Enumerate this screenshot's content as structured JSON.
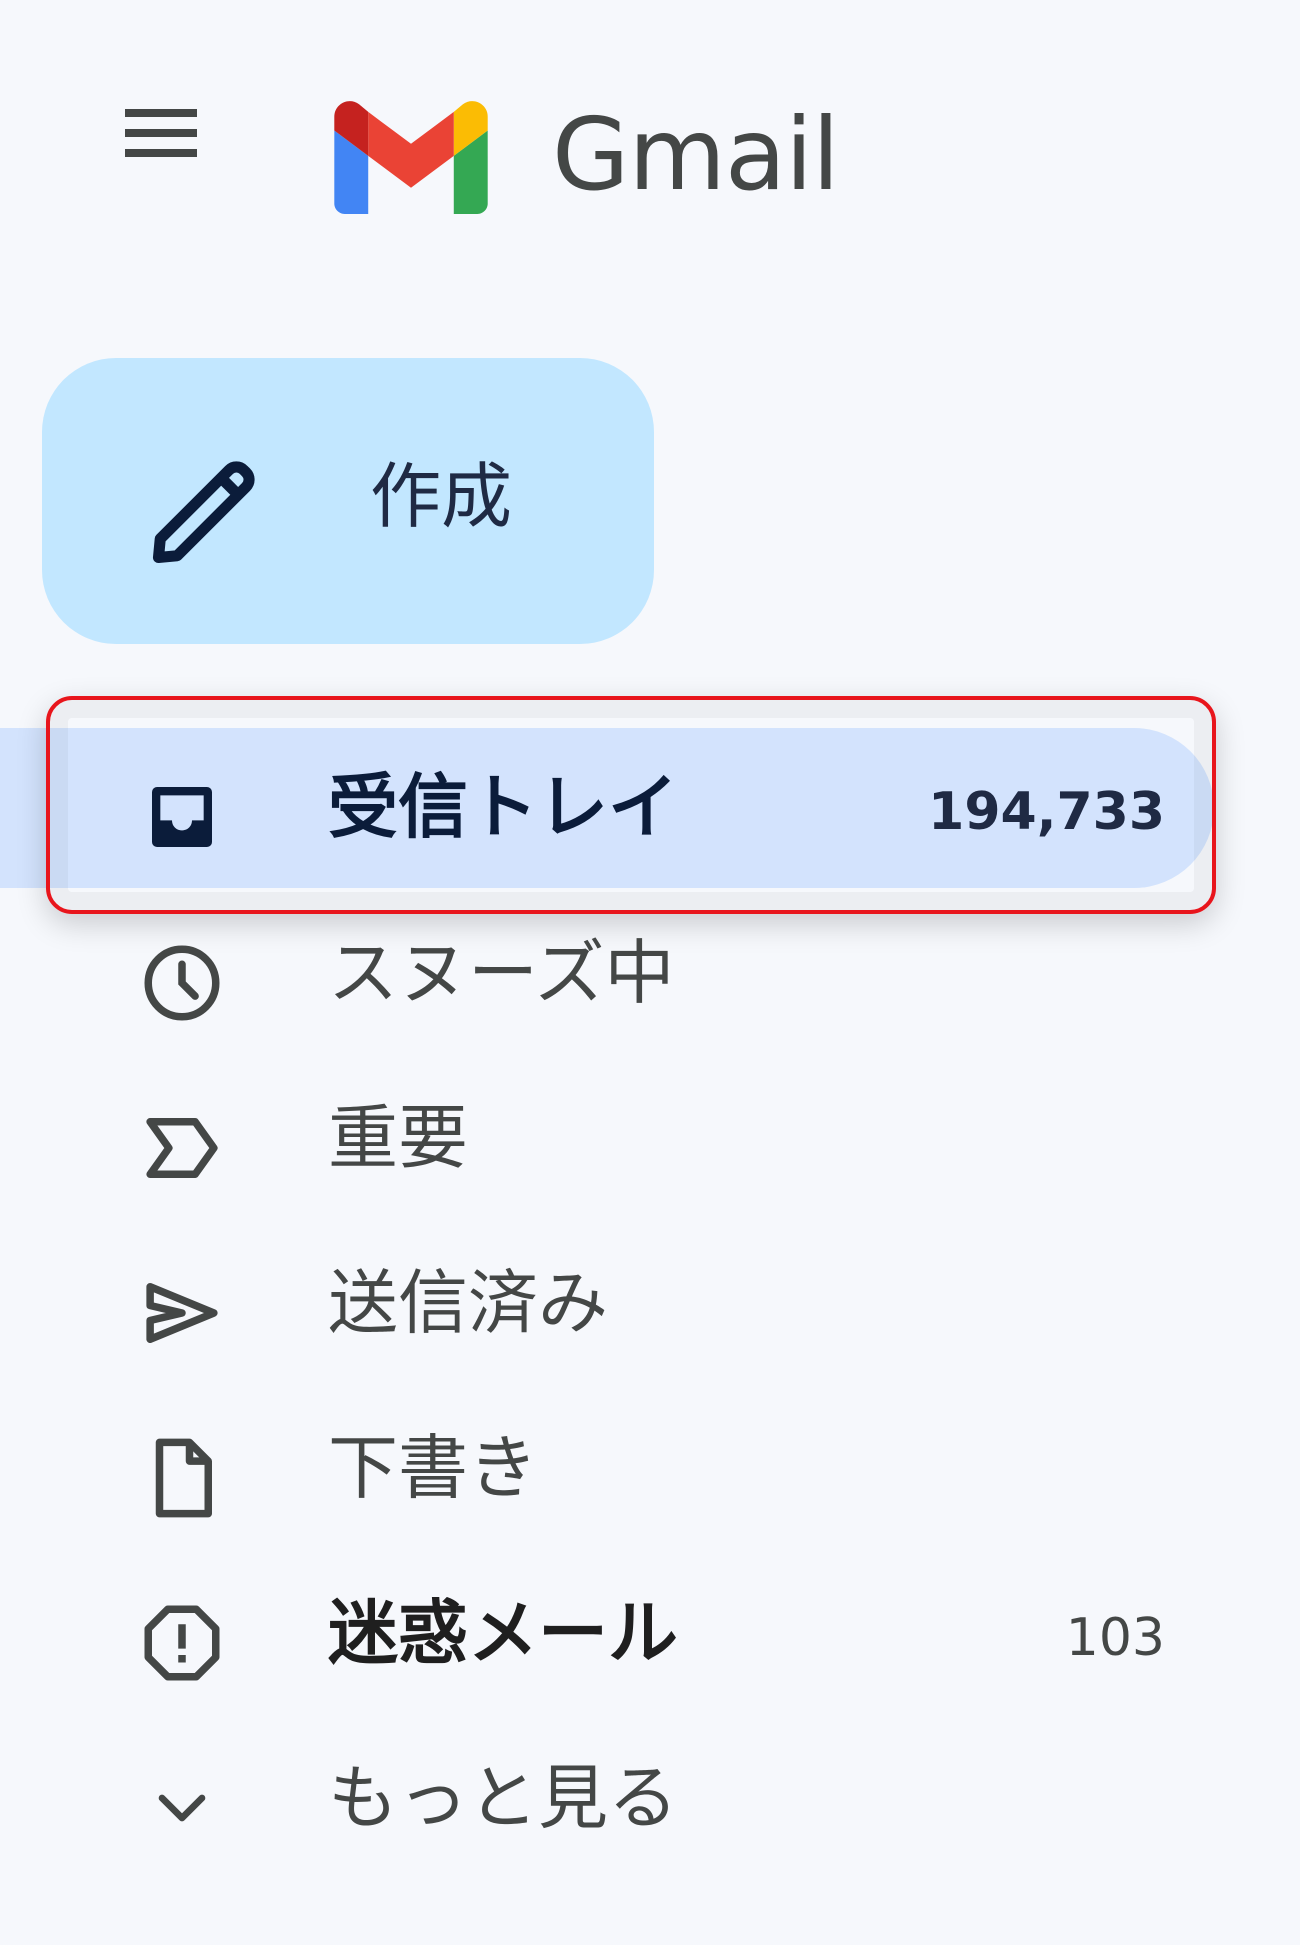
{
  "header": {
    "app_title": "Gmail",
    "menu_icon": "hamburger-menu-icon",
    "logo_icon": "gmail-m-logo",
    "logo_colors": [
      "#4285f4",
      "#34a853",
      "#fbbc04",
      "#ea4335",
      "#c5221f"
    ]
  },
  "compose": {
    "label": "作成",
    "icon": "pencil-icon"
  },
  "nav": {
    "items": [
      {
        "label": "受信トレイ",
        "count": "194,733",
        "icon": "inbox-icon",
        "selected": true,
        "bold": true
      },
      {
        "label": "スヌーズ中",
        "count": "",
        "icon": "clock-icon",
        "selected": false,
        "bold": false
      },
      {
        "label": "重要",
        "count": "",
        "icon": "important-label-icon",
        "selected": false,
        "bold": false
      },
      {
        "label": "送信済み",
        "count": "",
        "icon": "send-icon",
        "selected": false,
        "bold": false
      },
      {
        "label": "下書き",
        "count": "",
        "icon": "draft-icon",
        "selected": false,
        "bold": false
      },
      {
        "label": "迷惑メール",
        "count": "103",
        "icon": "spam-icon",
        "selected": false,
        "bold": true
      },
      {
        "label": "もっと見る",
        "count": "",
        "icon": "chevron-down-icon",
        "selected": false,
        "bold": false
      }
    ]
  },
  "colors": {
    "background": "#f6f8fc",
    "compose_bg": "#c2e7ff",
    "selected_bg": "#d3e3fd",
    "highlight_border": "#e8151c"
  }
}
